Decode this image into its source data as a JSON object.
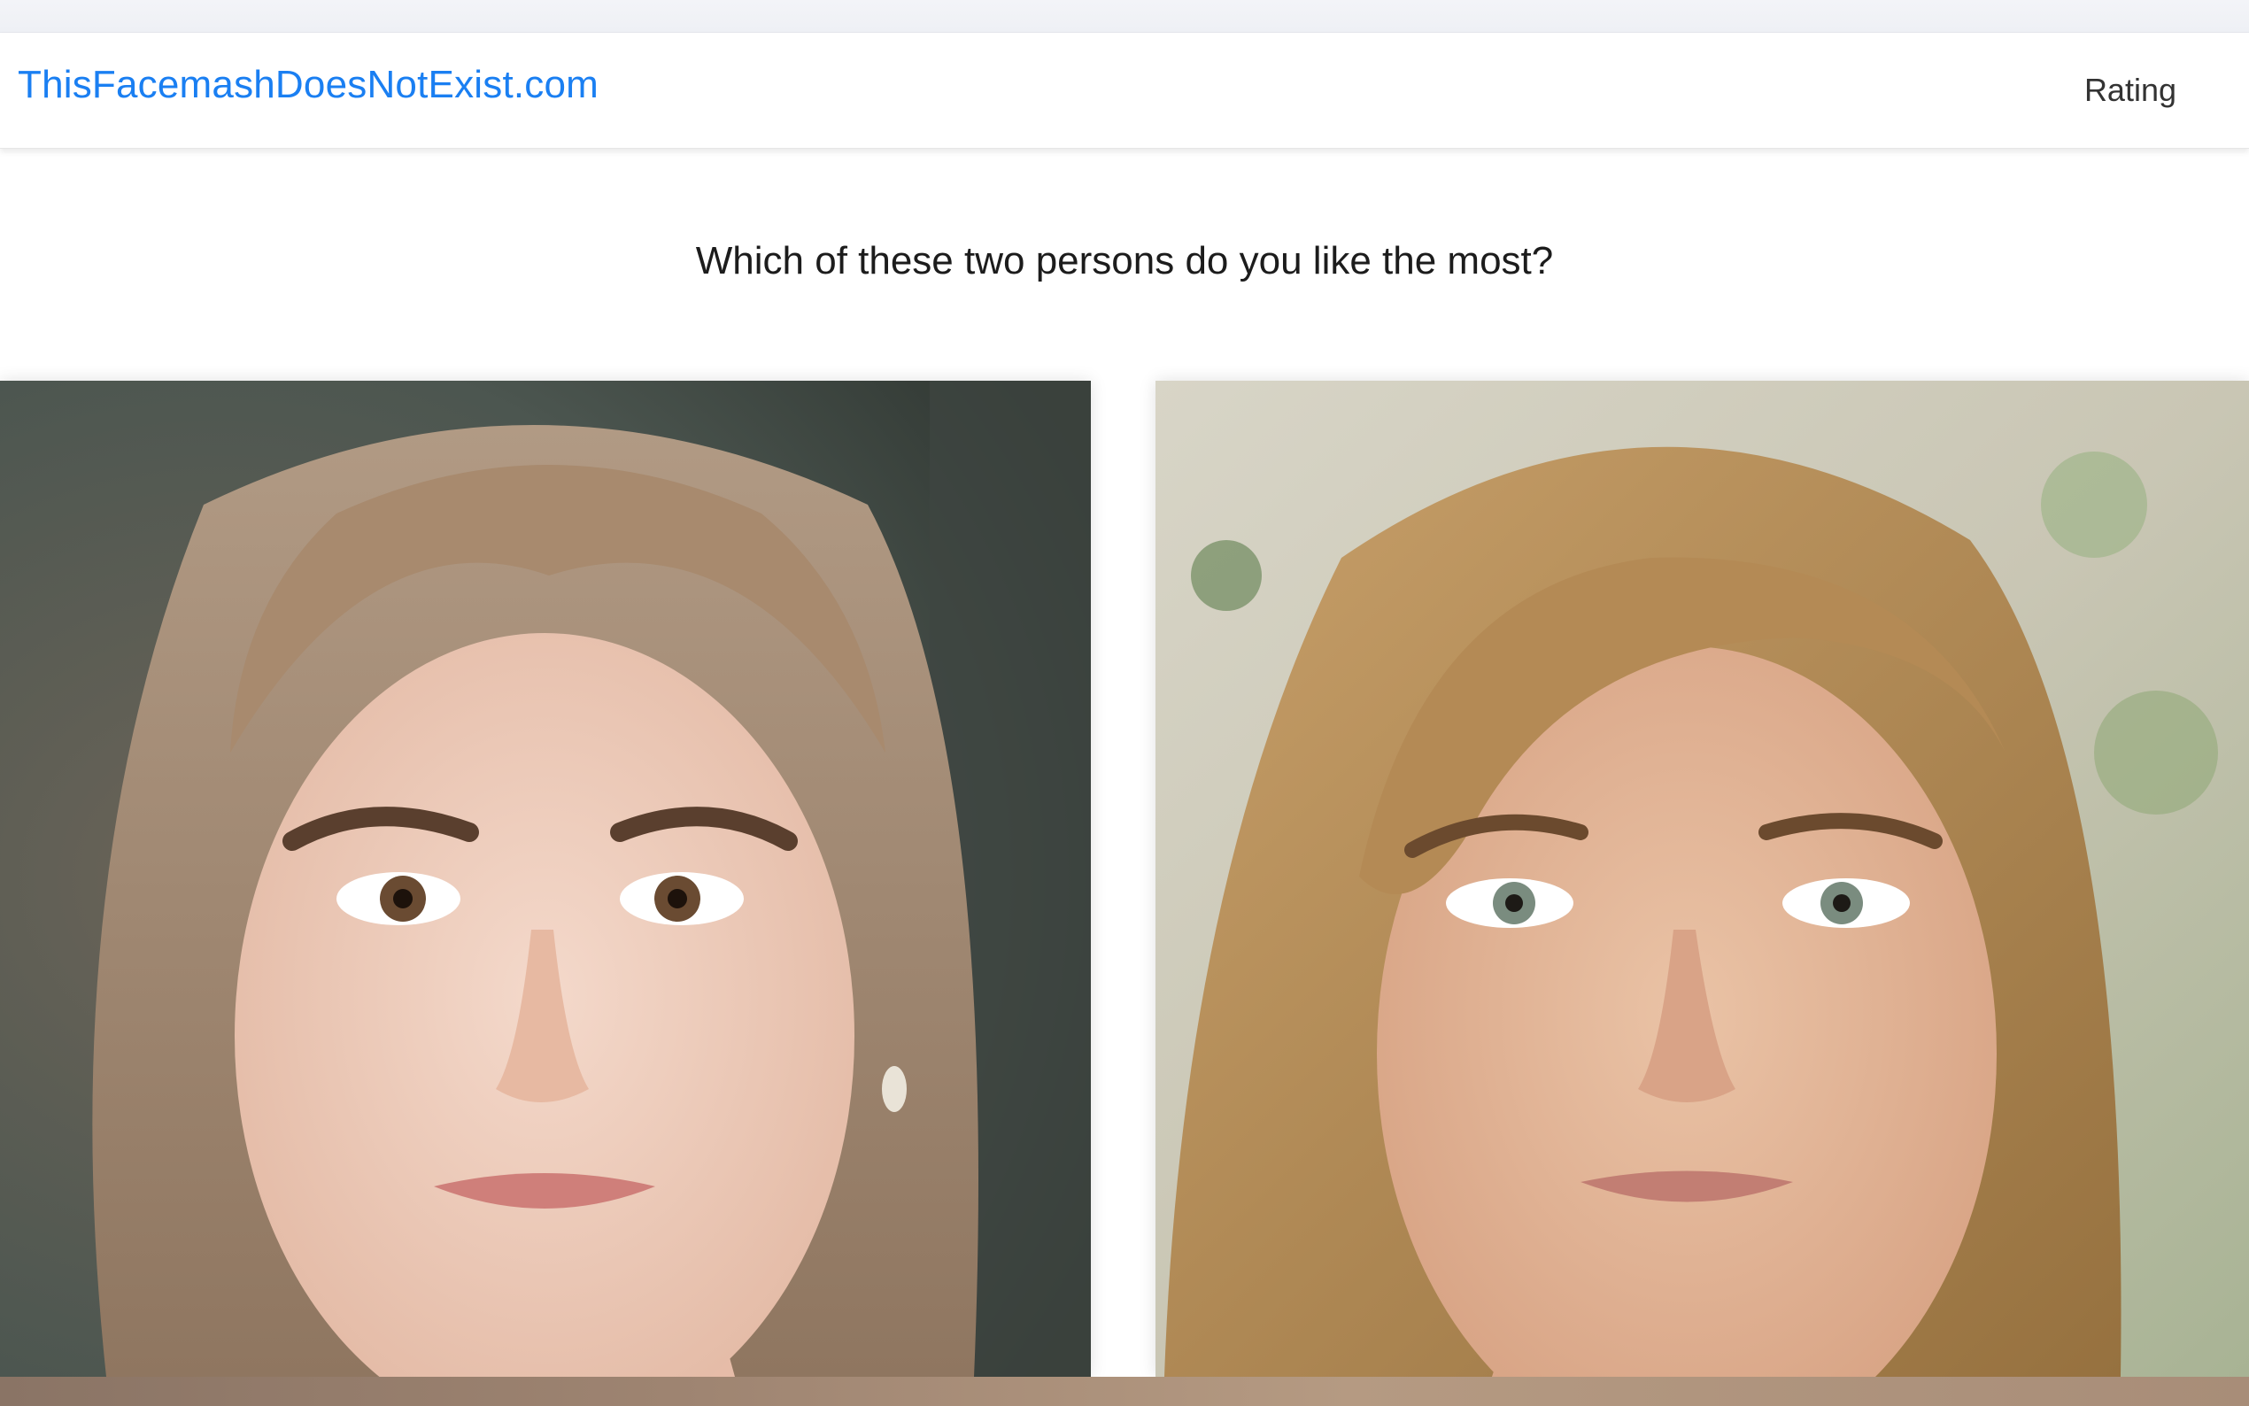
{
  "header": {
    "brand": "ThisFacemashDoesNotExist.com",
    "nav_rating": "Rating"
  },
  "main": {
    "question": "Which of these two persons do you like the most?",
    "candidates": [
      {
        "position": "left",
        "hair_color": "#a88a6e",
        "background_color": "#4c5650"
      },
      {
        "position": "right",
        "hair_color": "#b48a55",
        "background_color": "#c9c6b4"
      }
    ]
  },
  "colors": {
    "brand_link": "#1a7ff2",
    "text": "#1c1c1c",
    "nav_text": "#333333"
  }
}
